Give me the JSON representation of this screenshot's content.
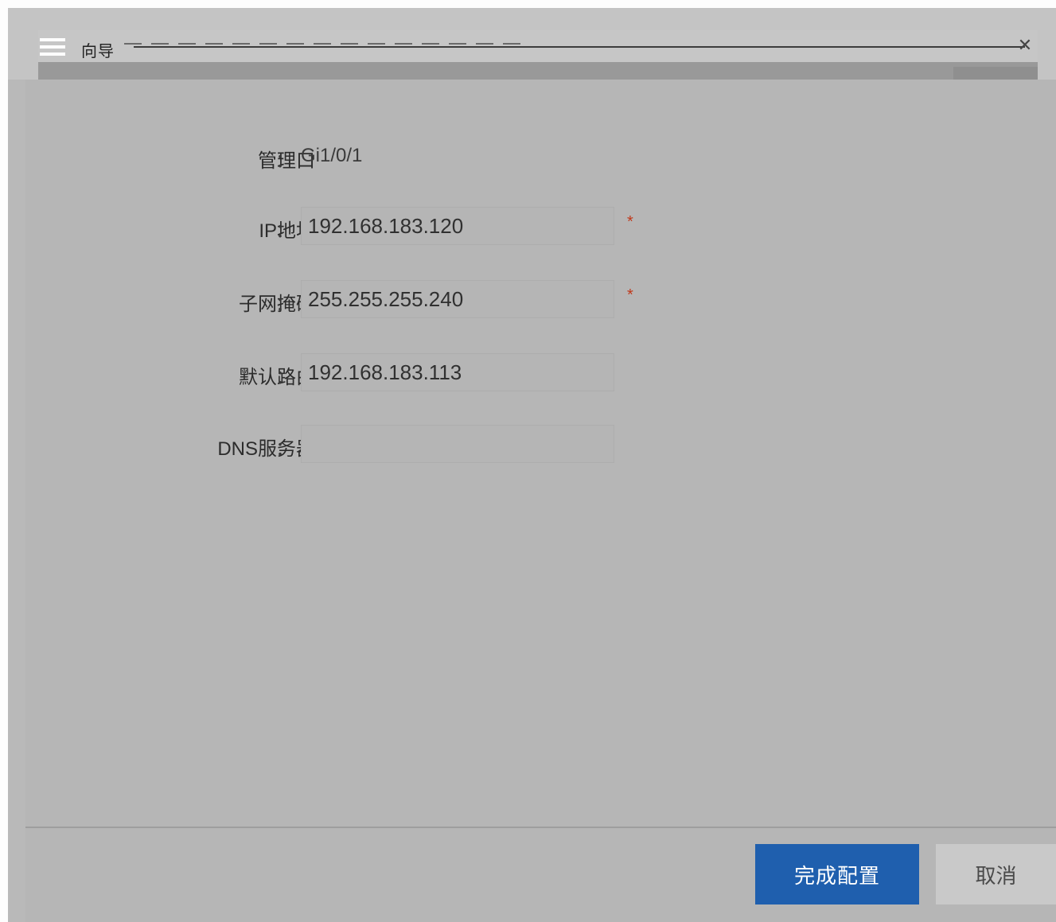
{
  "window": {
    "title": "向导",
    "close_glyph": "✕"
  },
  "form": {
    "mgmt_port": {
      "label": "管理口",
      "colon": "：",
      "value": "Gi1/0/1"
    },
    "ip": {
      "label": "IP地址",
      "colon": "：",
      "value": "192.168.183.120",
      "required": "*"
    },
    "mask": {
      "label": "子网掩码",
      "colon": "：",
      "value": "255.255.255.240",
      "required": "*"
    },
    "gateway": {
      "label": "默认路由",
      "colon": "：",
      "value": "192.168.183.113"
    },
    "dns": {
      "label": "DNS服务器",
      "colon": "：",
      "value": ""
    }
  },
  "footer": {
    "finish_label": "完成配置",
    "cancel_label": "取消"
  },
  "colors": {
    "primary_button": "#1f5fae",
    "required_star": "#c0391b",
    "dialog_bg": "#b6b6b6"
  },
  "icons": [
    "menu-icon",
    "close-icon"
  ]
}
